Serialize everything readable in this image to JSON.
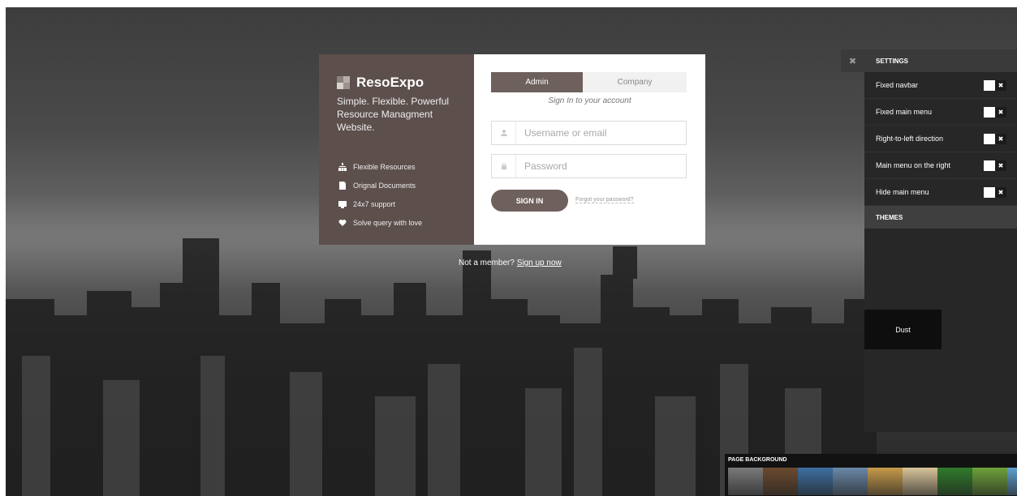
{
  "brand": {
    "name": "ResoExpo",
    "tagline": "Simple. Flexible. Powerful Resource Managment Website.",
    "features": [
      {
        "icon": "sitemap-icon",
        "label": "Flexible Resources"
      },
      {
        "icon": "document-icon",
        "label": "Orignal Documents"
      },
      {
        "icon": "support-icon",
        "label": "24x7 support"
      },
      {
        "icon": "heart-icon",
        "label": "Solve query with love"
      }
    ]
  },
  "login": {
    "tabs": [
      "Admin",
      "Company"
    ],
    "active_tab": "Admin",
    "caption": "Sign In to your account",
    "username_placeholder": "Username or email",
    "password_placeholder": "Password",
    "signin_label": "SIGN IN",
    "forgot_label": "Forgot your password?"
  },
  "signup": {
    "prefix": "Not a member?",
    "link": "Sign up now"
  },
  "settings": {
    "title": "SETTINGS",
    "close_icon": "✖",
    "options": [
      {
        "label": "Fixed navbar",
        "enabled": false
      },
      {
        "label": "Fixed main menu",
        "enabled": false
      },
      {
        "label": "Right-to-left direction",
        "enabled": false
      },
      {
        "label": "Main menu on the right",
        "enabled": false
      },
      {
        "label": "Hide main menu",
        "enabled": false
      }
    ],
    "toggle_off_glyph": "✖",
    "themes_title": "THEMES",
    "themes": [
      "Dust"
    ]
  },
  "page_background": {
    "title": "PAGE BACKGROUND",
    "thumbnails": [
      "#7a7a7a",
      "#6b4a2e",
      "#3d6fa0",
      "#6a88a8",
      "#c79a4a",
      "#d8c49a",
      "#2f7a2a",
      "#6ea13a",
      "#5f9fd0"
    ]
  }
}
